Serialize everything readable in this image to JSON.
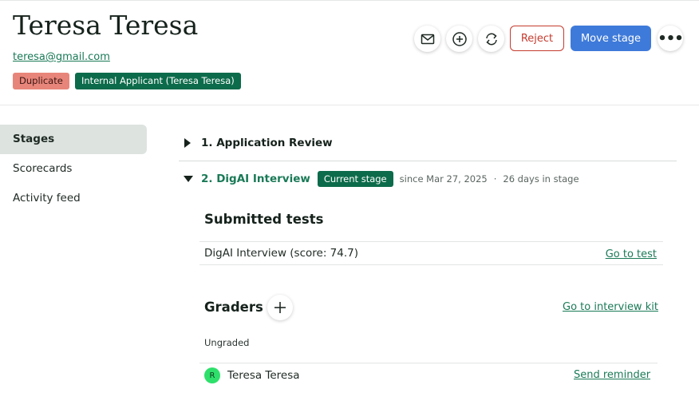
{
  "candidate": {
    "name": "Teresa Teresa",
    "email": "teresa@gmail.com",
    "badges": [
      {
        "label": "Duplicate",
        "color": "#e8857a"
      },
      {
        "label": "Internal Applicant (Teresa Teresa)",
        "color": "#0c6b4a"
      }
    ]
  },
  "header_actions": {
    "email_icon": "envelope-icon",
    "add_icon": "plus-circle-icon",
    "refresh_icon": "refresh-icon",
    "reject_label": "Reject",
    "move_stage_label": "Move stage",
    "more_label": "•••"
  },
  "sidebar": {
    "items": [
      {
        "label": "Stages",
        "active": true
      },
      {
        "label": "Scorecards",
        "active": false
      },
      {
        "label": "Activity feed",
        "active": false
      }
    ]
  },
  "stages": [
    {
      "title": "1. Application Review",
      "expanded": false
    },
    {
      "title": "2. DigAI Interview",
      "expanded": true,
      "badge": "Current stage",
      "since": "since Mar 27, 2025",
      "separator": "·",
      "days": "26 days in stage"
    }
  ],
  "submitted_tests": {
    "title": "Submitted tests",
    "rows": [
      {
        "name": "DigAI Interview (score: 74.7)",
        "link": "Go to test"
      }
    ]
  },
  "graders": {
    "title": "Graders",
    "kit_link": "Go to interview kit",
    "status": "Ungraded",
    "list": [
      {
        "initial": "R",
        "name": "Teresa Teresa",
        "action": "Send reminder"
      }
    ]
  },
  "colors": {
    "accent_green": "#1a7a57",
    "badge_green": "#0c6b4a",
    "primary_blue": "#3e7ad9",
    "reject_red": "#c43b2e"
  }
}
